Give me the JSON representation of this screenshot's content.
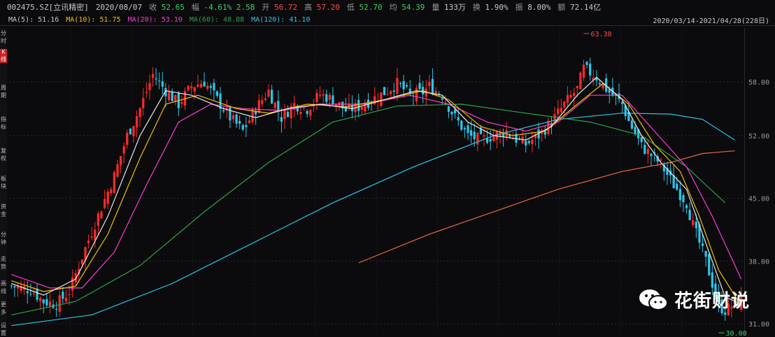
{
  "header": {
    "code": "002475.SZ[立讯精密]",
    "date": "2020/08/07",
    "close_label": "收",
    "close_value": "52.65",
    "change_label": "幅",
    "change_value": "-4.61%",
    "change_abs": "2.58",
    "open_label": "开",
    "open_value": "56.72",
    "high_label": "高",
    "high_value": "57.20",
    "low_label": "低",
    "low_value": "52.70",
    "avg_label": "均",
    "avg_value": "54.39",
    "volume_label": "量",
    "volume_value": "133万",
    "turnover_label": "换",
    "turnover_value": "1.90%",
    "amplitude_label": "振",
    "amplitude_value": "8.00%",
    "amount_label": "额",
    "amount_value": "72.14亿"
  },
  "ma_legend": [
    {
      "label": "MA(5):",
      "value": "51.16",
      "color": "#e8e8e8"
    },
    {
      "label": "MA(10):",
      "value": "51.75",
      "color": "#f0c000"
    },
    {
      "label": "MA(20):",
      "value": "53.10",
      "color": "#ff3ad0"
    },
    {
      "label": "MA(60):",
      "value": "48.88",
      "color": "#2aa24a"
    },
    {
      "label": "MA(120):",
      "value": "41.10",
      "color": "#2cc6e8"
    }
  ],
  "range_label": "2020/03/14-2021/04/28(228日)",
  "side_tags": [
    "分时",
    "K线",
    "周期",
    "指标",
    "复权",
    "板块",
    "资金",
    "分钟",
    "走势",
    "画线",
    "更多",
    "设置"
  ],
  "watermark": {
    "text": "花街财说"
  },
  "chart_data": {
    "type": "candlestick",
    "title": "",
    "ylim": [
      30,
      64
    ],
    "y_ticks": [
      {
        "value": 58,
        "label": "58.00"
      },
      {
        "value": 52,
        "label": "52.00"
      },
      {
        "value": 45,
        "label": "45.00"
      },
      {
        "value": 38,
        "label": "38.00"
      },
      {
        "value": 31,
        "label": "31.00"
      }
    ],
    "annotations": [
      {
        "label": "63.38",
        "x": 178,
        "y": 63.38
      },
      {
        "label": "30.00",
        "x": 220,
        "y": 30.0
      }
    ],
    "colors": {
      "up": "#ff2a2a",
      "down": "#2cc6e8",
      "ma250": "#e8674a"
    },
    "n_bars": 228,
    "close_path": [
      [
        0,
        35.2
      ],
      [
        6,
        34.8
      ],
      [
        10,
        33.5
      ],
      [
        14,
        33.2
      ],
      [
        18,
        34.6
      ],
      [
        22,
        38.5
      ],
      [
        28,
        44
      ],
      [
        32,
        47.5
      ],
      [
        36,
        52
      ],
      [
        40,
        55
      ],
      [
        44,
        58.8
      ],
      [
        48,
        57
      ],
      [
        52,
        55.5
      ],
      [
        56,
        57.5
      ],
      [
        60,
        58
      ],
      [
        64,
        56
      ],
      [
        68,
        54
      ],
      [
        72,
        52.5
      ],
      [
        76,
        55
      ],
      [
        80,
        57
      ],
      [
        84,
        54
      ],
      [
        88,
        55.5
      ],
      [
        92,
        55
      ],
      [
        96,
        56.6
      ],
      [
        100,
        56
      ],
      [
        104,
        54.8
      ],
      [
        108,
        55.2
      ],
      [
        112,
        56
      ],
      [
        116,
        56.8
      ],
      [
        120,
        57.8
      ],
      [
        124,
        56.5
      ],
      [
        128,
        56.8
      ],
      [
        130,
        57.5
      ],
      [
        134,
        56.5
      ],
      [
        138,
        54
      ],
      [
        142,
        52
      ],
      [
        146,
        51.5
      ],
      [
        150,
        52
      ],
      [
        154,
        52.5
      ],
      [
        156,
        51.8
      ],
      [
        160,
        51
      ],
      [
        164,
        52
      ],
      [
        168,
        53.5
      ],
      [
        172,
        55.5
      ],
      [
        176,
        57.2
      ],
      [
        178,
        59.5
      ],
      [
        182,
        58.5
      ],
      [
        186,
        56.8
      ],
      [
        190,
        55.5
      ],
      [
        192,
        53.6
      ],
      [
        196,
        50.8
      ],
      [
        200,
        49.5
      ],
      [
        202,
        48.8
      ],
      [
        206,
        46.5
      ],
      [
        210,
        44.5
      ],
      [
        212,
        42
      ],
      [
        216,
        38
      ],
      [
        218,
        35.5
      ],
      [
        220,
        33
      ],
      [
        222,
        32.5
      ],
      [
        224,
        33
      ],
      [
        227,
        33.5
      ]
    ],
    "ma5_path": [
      [
        0,
        35.5
      ],
      [
        10,
        34.2
      ],
      [
        20,
        36
      ],
      [
        30,
        43
      ],
      [
        40,
        52
      ],
      [
        48,
        57
      ],
      [
        56,
        56.5
      ],
      [
        66,
        55
      ],
      [
        76,
        54
      ],
      [
        86,
        55
      ],
      [
        96,
        55.5
      ],
      [
        106,
        55
      ],
      [
        116,
        56
      ],
      [
        126,
        57
      ],
      [
        134,
        56.5
      ],
      [
        142,
        53.5
      ],
      [
        150,
        52
      ],
      [
        160,
        51.5
      ],
      [
        168,
        53
      ],
      [
        176,
        56.5
      ],
      [
        182,
        58.5
      ],
      [
        190,
        56
      ],
      [
        196,
        52
      ],
      [
        202,
        49
      ],
      [
        210,
        46
      ],
      [
        216,
        40
      ],
      [
        222,
        34
      ],
      [
        227,
        33.2
      ]
    ],
    "ma10_path": [
      [
        0,
        35.8
      ],
      [
        10,
        34.6
      ],
      [
        20,
        35.2
      ],
      [
        30,
        41
      ],
      [
        40,
        49.5
      ],
      [
        48,
        55.5
      ],
      [
        58,
        56.5
      ],
      [
        70,
        55
      ],
      [
        80,
        54.5
      ],
      [
        92,
        55.5
      ],
      [
        104,
        55.2
      ],
      [
        116,
        56
      ],
      [
        128,
        57
      ],
      [
        136,
        56
      ],
      [
        146,
        53
      ],
      [
        156,
        52
      ],
      [
        166,
        52.5
      ],
      [
        176,
        55.5
      ],
      [
        184,
        57.8
      ],
      [
        192,
        55.5
      ],
      [
        200,
        51
      ],
      [
        208,
        48
      ],
      [
        214,
        43
      ],
      [
        220,
        37
      ],
      [
        227,
        33
      ]
    ],
    "ma20_path": [
      [
        0,
        36.5
      ],
      [
        12,
        35
      ],
      [
        22,
        35
      ],
      [
        32,
        39
      ],
      [
        42,
        46.5
      ],
      [
        52,
        53.5
      ],
      [
        62,
        55.5
      ],
      [
        72,
        55
      ],
      [
        84,
        54.8
      ],
      [
        96,
        55.5
      ],
      [
        110,
        55.5
      ],
      [
        124,
        56.5
      ],
      [
        136,
        55.5
      ],
      [
        148,
        53.5
      ],
      [
        160,
        52.5
      ],
      [
        170,
        53.5
      ],
      [
        180,
        56.5
      ],
      [
        190,
        56.5
      ],
      [
        200,
        52.5
      ],
      [
        210,
        48.5
      ],
      [
        218,
        43
      ],
      [
        227,
        36
      ]
    ],
    "ma60_path": [
      [
        0,
        32
      ],
      [
        20,
        33.5
      ],
      [
        40,
        37.5
      ],
      [
        60,
        43.5
      ],
      [
        80,
        49
      ],
      [
        100,
        53.5
      ],
      [
        120,
        55.3
      ],
      [
        140,
        55.5
      ],
      [
        160,
        54.5
      ],
      [
        180,
        53.5
      ],
      [
        196,
        52
      ],
      [
        210,
        48.5
      ],
      [
        222,
        44.5
      ]
    ],
    "ma120_path": [
      [
        0,
        30.8
      ],
      [
        25,
        32
      ],
      [
        50,
        35.5
      ],
      [
        75,
        40
      ],
      [
        100,
        44.5
      ],
      [
        125,
        48.5
      ],
      [
        150,
        52
      ],
      [
        170,
        53.8
      ],
      [
        190,
        54.5
      ],
      [
        205,
        54.4
      ],
      [
        215,
        53.8
      ],
      [
        225,
        51.5
      ]
    ],
    "ma250_path": [
      [
        108,
        37.8
      ],
      [
        130,
        41
      ],
      [
        150,
        43.5
      ],
      [
        170,
        46
      ],
      [
        190,
        48
      ],
      [
        205,
        49
      ],
      [
        215,
        50
      ],
      [
        225,
        50.3
      ]
    ]
  }
}
